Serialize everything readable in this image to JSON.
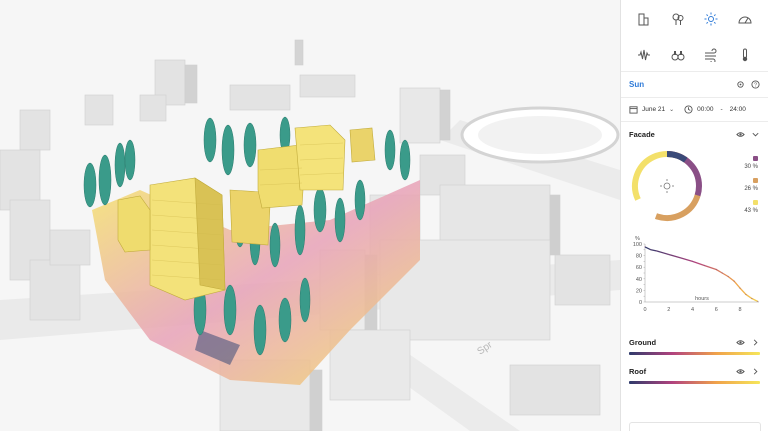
{
  "toolbar": {
    "tools": [
      {
        "name": "buildings",
        "icon": "buildings-icon"
      },
      {
        "name": "trees",
        "icon": "trees-icon"
      },
      {
        "name": "sun",
        "icon": "sun-icon"
      },
      {
        "name": "daylight",
        "icon": "daylight-icon"
      },
      {
        "name": "noise",
        "icon": "noise-icon"
      },
      {
        "name": "view",
        "icon": "binoculars-icon"
      },
      {
        "name": "wind",
        "icon": "wind-icon"
      },
      {
        "name": "temperature",
        "icon": "thermometer-icon"
      }
    ],
    "active": "sun"
  },
  "sun": {
    "title": "Sun",
    "date": "June 21",
    "time_start": "00:00",
    "time_sep": "-",
    "time_end": "24:00"
  },
  "facade": {
    "title": "Facade",
    "legend": [
      {
        "label": "30 %",
        "color": "#8a4f86"
      },
      {
        "label": "26 %",
        "color": "#d8a060"
      },
      {
        "label": "43 %",
        "color": "#f3e06a"
      }
    ]
  },
  "chart_data": {
    "type": "line",
    "ylabel": "%",
    "xlabel": "hours",
    "yticks": [
      0,
      10,
      20,
      30,
      40,
      50,
      60,
      70,
      80,
      90,
      100
    ],
    "xticks": [
      0,
      2,
      4,
      6,
      8
    ],
    "xlim": [
      0,
      9.6
    ],
    "ylim": [
      0,
      100
    ],
    "x": [
      0,
      0.5,
      1,
      2,
      3,
      4,
      5,
      6,
      6.5,
      7,
      7.5,
      8,
      8.5,
      9,
      9.5
    ],
    "values": [
      95,
      90,
      88,
      82,
      76,
      70,
      63,
      56,
      50,
      44,
      36,
      24,
      13,
      6,
      1
    ]
  },
  "ground": {
    "title": "Ground"
  },
  "roof": {
    "title": "Roof"
  },
  "map": {
    "street_label": "Spr"
  },
  "colors": {
    "accent": "#2f7bd8",
    "sun_low": "#2e3a6b",
    "sun_mid": "#b2437e",
    "sun_high": "#f6e65a"
  }
}
